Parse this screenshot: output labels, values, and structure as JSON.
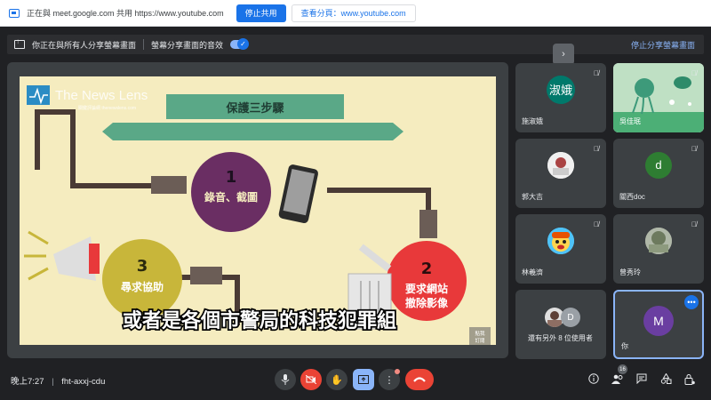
{
  "sharebar": {
    "message": "正在與 meet.google.com 共用 https://www.youtube.com",
    "stop_label": "停止共用",
    "view_label": "查看分頁：www.youtube.com"
  },
  "presbar": {
    "sharing_label": "你正在與所有人分享螢幕畫面",
    "audio_label": "螢幕分享畫面的音效",
    "stop_label": "停止分享螢幕畫面"
  },
  "collapse_icon": "›",
  "slide": {
    "logo": "The News Lens",
    "logo_sub": "關鍵評論網 thenewslens.com",
    "banner": "保護三步驟",
    "step1_num": "1",
    "step1_text": "錄音、截圖",
    "step2_num": "2",
    "step2_text1": "要求網站",
    "step2_text2": "撤除影像",
    "step3_num": "3",
    "step3_text": "尋求協助",
    "subtitle": "或者是各個市警局的科技犯罪組",
    "watermark1": "點我",
    "watermark2": "訂閱"
  },
  "participants": [
    {
      "name": "施淑娥",
      "avatar_text": "淑娥",
      "avatar_color": "#00796b"
    },
    {
      "name": "吳佳珉",
      "avatar_text": "",
      "avatar_color": ""
    },
    {
      "name": "郭大吉",
      "avatar_text": "",
      "avatar_color": ""
    },
    {
      "name": "關西doc",
      "avatar_text": "d",
      "avatar_color": "#2e7d32"
    },
    {
      "name": "林羲濟",
      "avatar_text": "",
      "avatar_color": ""
    },
    {
      "name": "曾秀玲",
      "avatar_text": "",
      "avatar_color": ""
    },
    {
      "name": "還有另外 8 位使用者",
      "avatar_text": "D",
      "avatar_color": "#9aa0a6"
    },
    {
      "name": "你",
      "avatar_text": "M",
      "avatar_color": "#6a3ea1"
    }
  ],
  "bottom": {
    "clock": "晚上7:27",
    "separator": "|",
    "meeting_code": "fht-axxj-cdu",
    "people_count": "16"
  },
  "colors": {
    "accent": "#1a73e8",
    "end_call": "#ea4335",
    "meet_bg": "#202124",
    "tile_bg": "#3c4043"
  },
  "icons": {
    "mic": "microphone-icon",
    "camera": "camera-off-icon",
    "hand": "raise-hand-icon",
    "present": "present-icon",
    "more": "more-options-icon",
    "end": "end-call-icon",
    "info": "info-icon",
    "people": "people-icon",
    "chat": "chat-icon",
    "activities": "activities-icon",
    "lock": "host-controls-icon"
  }
}
